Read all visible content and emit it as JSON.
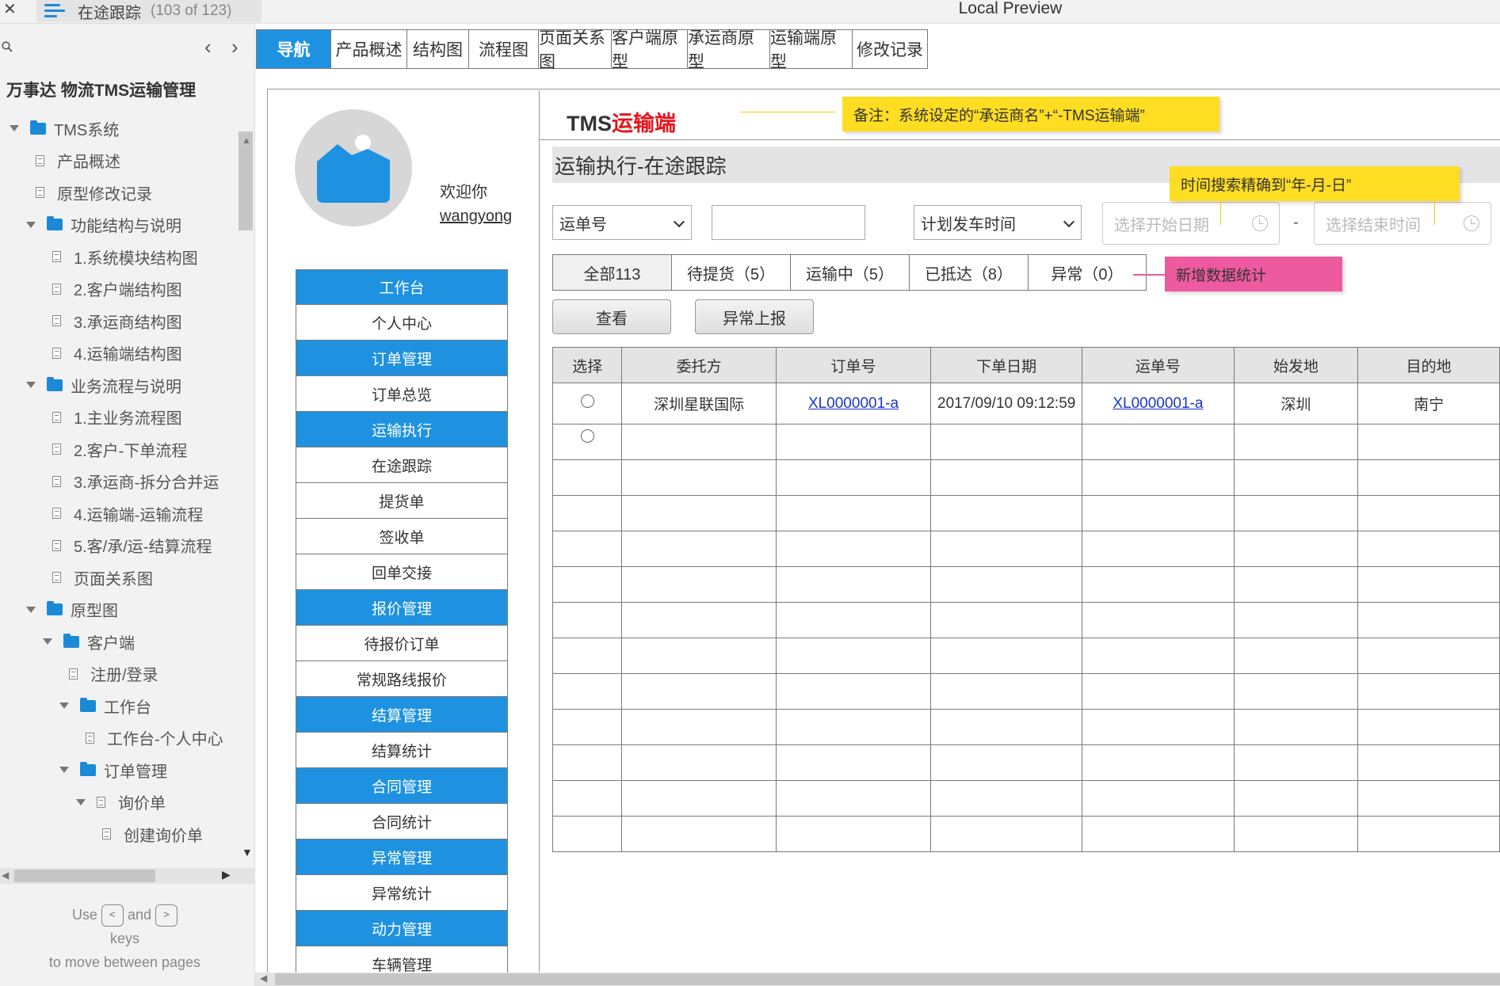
{
  "window": {
    "title": "Local Preview",
    "page_name": "在途跟踪",
    "page_count": "(103 of 123)"
  },
  "sidebar": {
    "project_title": "万事达 物流TMS运输管理",
    "tree": [
      {
        "label": "TMS系统",
        "type": "folder",
        "level": 0,
        "expanded": true
      },
      {
        "label": "产品概述",
        "type": "page",
        "level": 1
      },
      {
        "label": "原型修改记录",
        "type": "page",
        "level": 1
      },
      {
        "label": "功能结构与说明",
        "type": "folder",
        "level": 1,
        "expanded": true
      },
      {
        "label": "1.系统模块结构图",
        "type": "page",
        "level": 2
      },
      {
        "label": "2.客户端结构图",
        "type": "page",
        "level": 2
      },
      {
        "label": "3.承运商结构图",
        "type": "page",
        "level": 2
      },
      {
        "label": "4.运输端结构图",
        "type": "page",
        "level": 2
      },
      {
        "label": "业务流程与说明",
        "type": "folder",
        "level": 1,
        "expanded": true
      },
      {
        "label": "1.主业务流程图",
        "type": "page",
        "level": 2
      },
      {
        "label": "2.客户-下单流程",
        "type": "page",
        "level": 2
      },
      {
        "label": "3.承运商-拆分合并运",
        "type": "page",
        "level": 2
      },
      {
        "label": "4.运输端-运输流程",
        "type": "page",
        "level": 2
      },
      {
        "label": "5.客/承/运-结算流程",
        "type": "page",
        "level": 2
      },
      {
        "label": "页面关系图",
        "type": "page",
        "level": 2
      },
      {
        "label": "原型图",
        "type": "folder",
        "level": 1,
        "expanded": true
      },
      {
        "label": "客户端",
        "type": "folder",
        "level": 2,
        "expanded": true
      },
      {
        "label": "注册/登录",
        "type": "page",
        "level": 3
      },
      {
        "label": "工作台",
        "type": "folder",
        "level": 3,
        "expanded": true
      },
      {
        "label": "工作台-个人中心",
        "type": "page",
        "level": 4
      },
      {
        "label": "订单管理",
        "type": "folder",
        "level": 3,
        "expanded": true
      },
      {
        "label": "询价单",
        "type": "page-expandable",
        "level": 4,
        "expanded": true
      },
      {
        "label": "创建询价单",
        "type": "page",
        "level": 5
      }
    ],
    "hint_use": "Use",
    "hint_and": "and",
    "hint_keys": "keys",
    "hint_rest": "to move between pages",
    "key_prev": "<",
    "key_next": ">"
  },
  "tabs": [
    "导航",
    "产品概述",
    "结构图",
    "流程图",
    "页面关系图",
    "客户端原型",
    "承运商原型",
    "运输端原型",
    "修改记录"
  ],
  "profile": {
    "welcome": "欢迎你",
    "username": "wangyong"
  },
  "left_nav": [
    {
      "label": "工作台",
      "header": true
    },
    {
      "label": "个人中心",
      "header": false
    },
    {
      "label": "订单管理",
      "header": true
    },
    {
      "label": "订单总览",
      "header": false
    },
    {
      "label": "运输执行",
      "header": true
    },
    {
      "label": "在途跟踪",
      "header": false
    },
    {
      "label": "提货单",
      "header": false
    },
    {
      "label": "签收单",
      "header": false
    },
    {
      "label": "回单交接",
      "header": false
    },
    {
      "label": "报价管理",
      "header": true
    },
    {
      "label": "待报价订单",
      "header": false
    },
    {
      "label": "常规路线报价",
      "header": false
    },
    {
      "label": "结算管理",
      "header": true
    },
    {
      "label": "结算统计",
      "header": false
    },
    {
      "label": "合同管理",
      "header": true
    },
    {
      "label": "合同统计",
      "header": false
    },
    {
      "label": "异常管理",
      "header": true
    },
    {
      "label": "异常统计",
      "header": false
    },
    {
      "label": "动力管理",
      "header": true
    },
    {
      "label": "车辆管理",
      "header": false
    }
  ],
  "brand": {
    "prefix": "TMS",
    "suffix": "运输端"
  },
  "notes": {
    "note1": "备注：系统设定的“承运商名”+“-TMS运输端”",
    "note2": "时间搜索精确到“年-月-日”",
    "note3": "新增数据统计"
  },
  "page_heading": "运输执行-在途跟踪",
  "filters": {
    "waybill_select": "运单号",
    "waybill_input": "",
    "time_select": "计划发车时间",
    "start_date_placeholder": "选择开始日期",
    "end_date_placeholder": "选择结束时间",
    "dash": "-"
  },
  "status_tabs": [
    {
      "label": "全部113",
      "active": true
    },
    {
      "label": "待提货（5）",
      "active": false
    },
    {
      "label": "运输中（5）",
      "active": false
    },
    {
      "label": "已抵达（8）",
      "active": false
    },
    {
      "label": "异常（0）",
      "active": false
    }
  ],
  "buttons": {
    "view": "查看",
    "report": "异常上报"
  },
  "table": {
    "columns": [
      "选择",
      "委托方",
      "订单号",
      "下单日期",
      "运单号",
      "始发地",
      "目的地"
    ],
    "rows": [
      {
        "client": "深圳星联国际",
        "order_no": "XL0000001-a",
        "order_date": "2017/09/10 09:12:59",
        "waybill_no": "XL0000001-a",
        "origin": "深圳",
        "destination": "南宁"
      }
    ],
    "empty_rows": 12
  },
  "colors": {
    "accent": "#1e92e0",
    "brand_red": "#e8141c",
    "note_yellow": "#ffdd22",
    "note_pink": "#ed5a9f",
    "link": "#1a36c8"
  }
}
